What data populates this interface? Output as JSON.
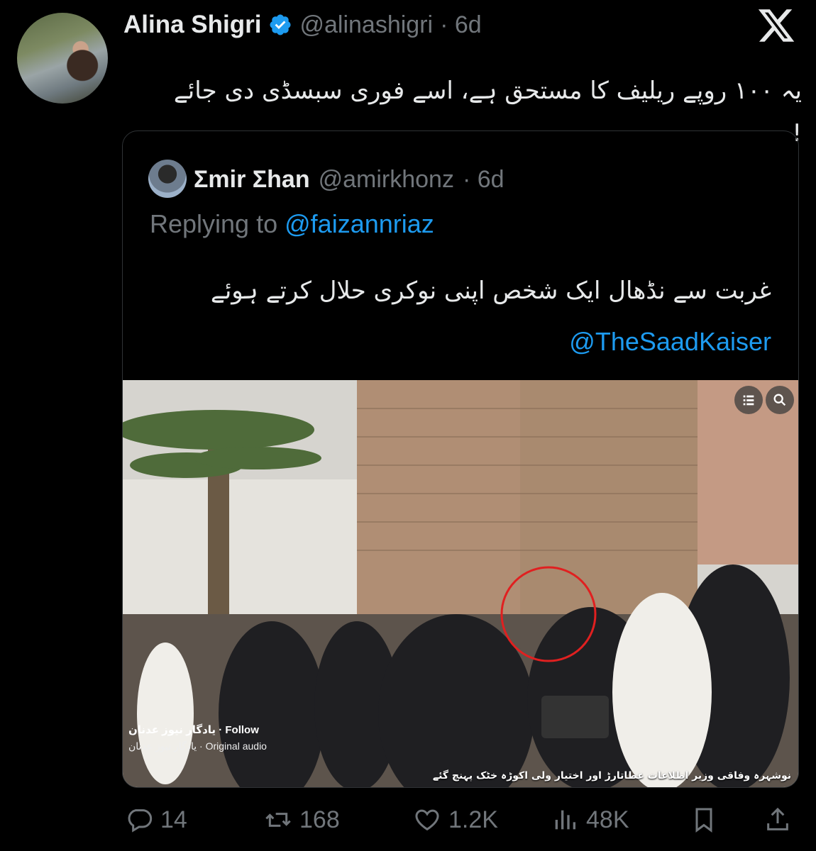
{
  "tweet": {
    "author_name": "Alina Shigri",
    "author_handle": "@alinashigri",
    "time": "· 6d",
    "text": "یہ ۱۰۰ روپے ریلیف کا مستحق ہے، اسے فوری سبسڈی دی جائے !"
  },
  "quoted_tweet": {
    "author_name": "Σmir Σhan",
    "author_handle": "@amirkhonz",
    "time": "· 6d",
    "replying_to_label": "Replying to",
    "replying_to_handle": "@faizannriaz",
    "text": "غربت سے نڈھال ایک شخص اپنی نوکری حلال کرتے ہوئے",
    "link": "@TheSaadKaiser"
  },
  "media_overlay": {
    "account": "یادگار نیوز عدنان",
    "follow_label": "· Follow",
    "audio": "یادگار نیوز عدنان · Original audio",
    "caption": "نوشہرہ وفاقی وزیر اطلاعات عطاتارڑ اور اختیار ولی اکوڑہ خٹک پہنچ گئے"
  },
  "actions": {
    "replies": "14",
    "reposts": "168",
    "likes": "1.2K",
    "views": "48K"
  },
  "icons": [
    "verified-badge-icon",
    "x-logo-icon",
    "list-icon",
    "search-icon",
    "reply-icon",
    "repost-icon",
    "like-icon",
    "views-icon",
    "bookmark-icon",
    "share-icon"
  ],
  "colors": {
    "background": "#000000",
    "text": "#e7e9ea",
    "muted": "#71767b",
    "accent": "#1d9bf0",
    "border": "#2f3336"
  }
}
